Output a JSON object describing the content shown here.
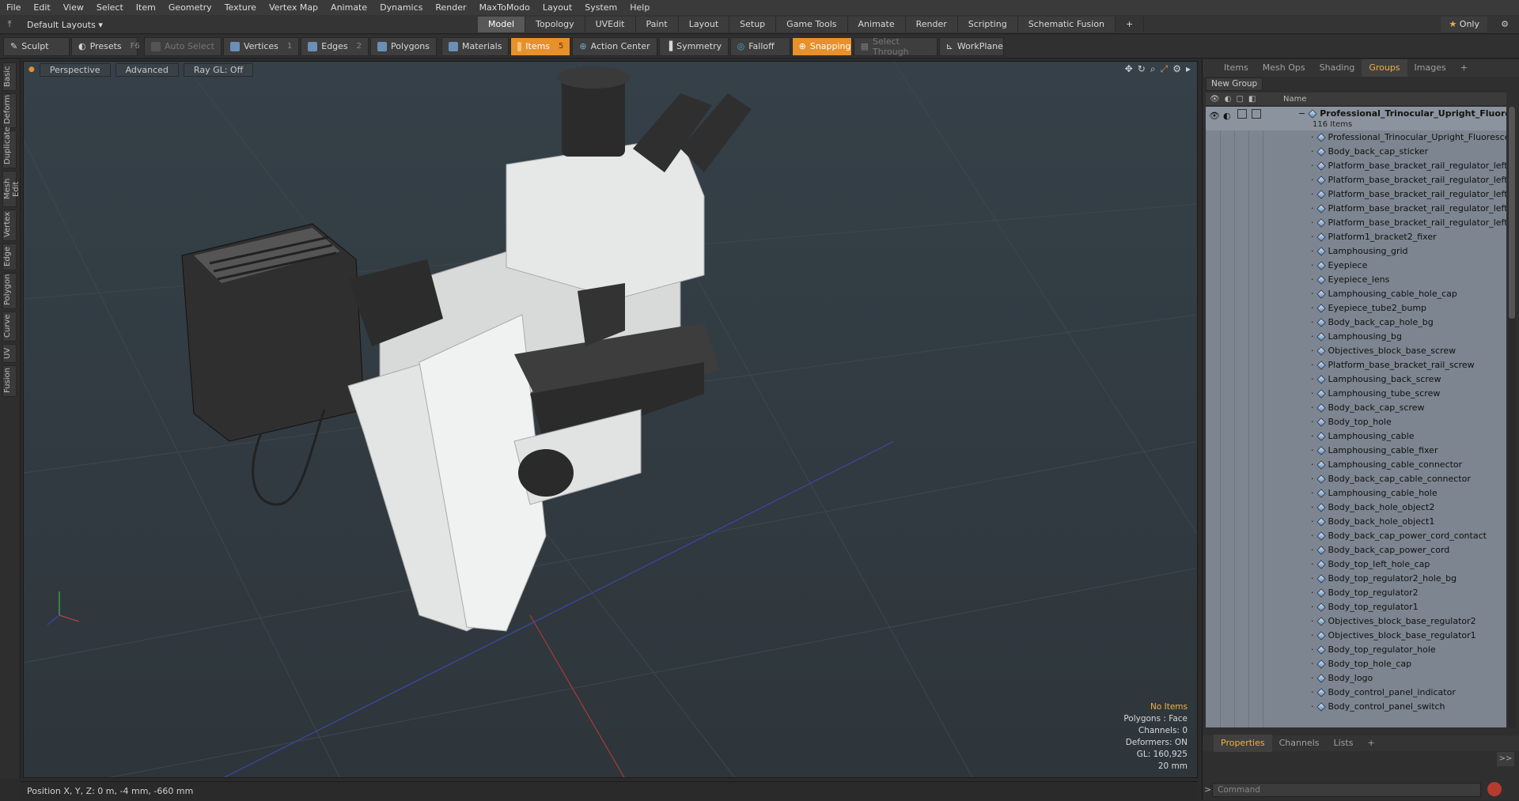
{
  "menubar": {
    "items": [
      "File",
      "Edit",
      "View",
      "Select",
      "Item",
      "Geometry",
      "Texture",
      "Vertex Map",
      "Animate",
      "Dynamics",
      "Render",
      "MaxToModo",
      "Layout",
      "System",
      "Help"
    ]
  },
  "layoutbar": {
    "layouts_label": "Default Layouts",
    "tabs": [
      "Model",
      "Topology",
      "UVEdit",
      "Paint",
      "Layout",
      "Setup",
      "Game Tools",
      "Animate",
      "Render",
      "Scripting",
      "Schematic Fusion"
    ],
    "active_tab": "Model",
    "only_label": "Only"
  },
  "toolbar": {
    "sculpt": "Sculpt",
    "presets": "Presets",
    "presets_key": "F6",
    "auto_select": "Auto Select",
    "vertices": "Vertices",
    "vertices_key": "1",
    "edges": "Edges",
    "edges_key": "2",
    "polygons": "Polygons",
    "materials": "Materials",
    "items": "Items",
    "items_key": "5",
    "action_center": "Action Center",
    "symmetry": "Symmetry",
    "falloff": "Falloff",
    "snapping": "Snapping",
    "select_through": "Select Through",
    "workplane": "WorkPlane"
  },
  "left_tabs": [
    "Basic",
    "Deform",
    "Duplicate",
    "Mesh Edit",
    "Vertex",
    "Edge",
    "Polygon",
    "Curve",
    "UV",
    "Fusion"
  ],
  "viewport": {
    "view": "Perspective",
    "shading": "Advanced",
    "raygl": "Ray GL: Off",
    "stats": {
      "items": "No Items",
      "polygons": "Polygons : Face",
      "channels": "Channels: 0",
      "deformers": "Deformers: ON",
      "gl": "GL: 160,925",
      "scale": "20 mm"
    }
  },
  "status": {
    "position": "Position X, Y, Z:   0 m, -4 mm, -660 mm"
  },
  "right_panel": {
    "tabs": [
      "Items",
      "Mesh Ops",
      "Shading",
      "Groups",
      "Images"
    ],
    "active_tab": "Groups",
    "new_group": "New Group",
    "col_name": "Name",
    "group_name": "Professional_Trinocular_Upright_Fluoresc ...",
    "group_count": "116 Items",
    "items": [
      "Professional_Trinocular_Upright_Fluorescence_...",
      "Body_back_cap_sticker",
      "Platform_base_bracket_rail_regulator_left",
      "Platform_base_bracket_rail_regulator_left_pivot",
      "Platform_base_bracket_rail_regulator_left_cap",
      "Platform_base_bracket_rail_regulator_left_dial",
      "Platform_base_bracket_rail_regulator_left_screw",
      "Platform1_bracket2_fixer",
      "Lamphousing_grid",
      "Eyepiece",
      "Eyepiece_lens",
      "Lamphousing_cable_hole_cap",
      "Eyepiece_tube2_bump",
      "Body_back_cap_hole_bg",
      "Lamphousing_bg",
      "Objectives_block_base_screw",
      "Platform_base_bracket_rail_screw",
      "Lamphousing_back_screw",
      "Lamphousing_tube_screw",
      "Body_back_cap_screw",
      "Body_top_hole",
      "Lamphousing_cable",
      "Lamphousing_cable_fixer",
      "Lamphousing_cable_connector",
      "Body_back_cap_cable_connector",
      "Lamphousing_cable_hole",
      "Body_back_hole_object2",
      "Body_back_hole_object1",
      "Body_back_cap_power_cord_contact",
      "Body_back_cap_power_cord",
      "Body_top_left_hole_cap",
      "Body_top_regulator2_hole_bg",
      "Body_top_regulator2",
      "Body_top_regulator1",
      "Objectives_block_base_regulator2",
      "Objectives_block_base_regulator1",
      "Body_top_regulator_hole",
      "Body_top_hole_cap",
      "Body_logo",
      "Body_control_panel_indicator",
      "Body_control_panel_switch"
    ],
    "bottom_tabs": [
      "Properties",
      "Channels",
      "Lists"
    ],
    "bottom_active": "Properties",
    "command_placeholder": "Command",
    "expand_label": ">>"
  },
  "colors": {
    "accent": "#e8902a",
    "highlight_text": "#f0b040",
    "list_bg": "#7c8590"
  }
}
